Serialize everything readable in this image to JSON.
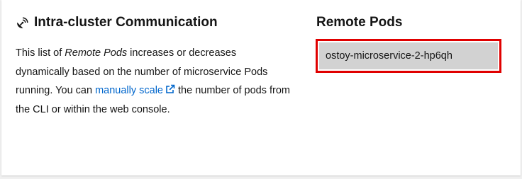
{
  "intra": {
    "title": "Intra-cluster Communication",
    "icon": "satellite-dish-icon",
    "text_1": "This list of ",
    "text_em": "Remote Pods",
    "text_2": " increases or decreases dynamically based on the number of microservice Pods running. You can ",
    "link_label": "manually scale",
    "link_icon": "external-link-icon",
    "text_3": " the number of pods from the CLI or within the web console."
  },
  "remote_pods": {
    "title": "Remote Pods",
    "items": [
      "ostoy-microservice-2-hp6qh"
    ]
  },
  "colors": {
    "link": "#0066cc",
    "highlight_border": "#e00000",
    "pod_bg": "#d2d2d2"
  }
}
